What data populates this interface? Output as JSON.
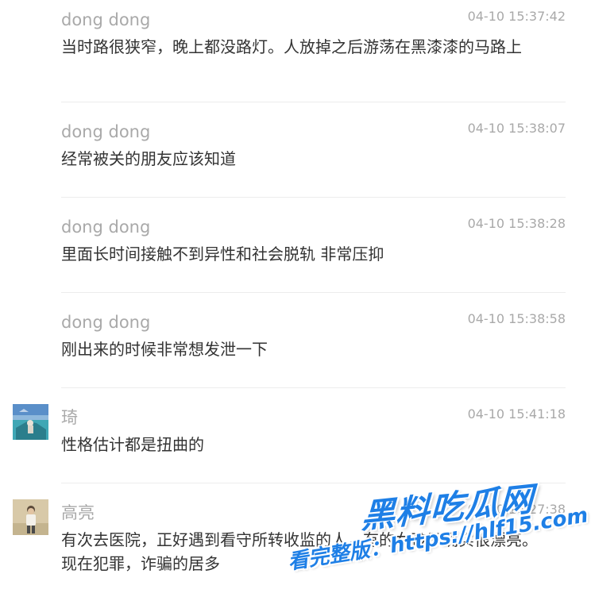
{
  "comments": [
    {
      "author": "dong dong",
      "time": "04-10 15:37:42",
      "text": "当时路很狭窄，晚上都没路灯。人放掉之后游荡在黑漆漆的马路上",
      "avatar": null
    },
    {
      "author": "dong dong",
      "time": "04-10 15:38:07",
      "text": "经常被关的朋友应该知道",
      "avatar": null
    },
    {
      "author": "dong dong",
      "time": "04-10 15:38:28",
      "text": "里面长时间接触不到异性和社会脱轨 非常压抑",
      "avatar": null
    },
    {
      "author": "dong dong",
      "time": "04-10 15:38:58",
      "text": "刚出来的时候非常想发泄一下",
      "avatar": null
    },
    {
      "author": "琦",
      "time": "04-10 15:41:18",
      "text": "性格估计都是扭曲的",
      "avatar": "avatar-beach"
    },
    {
      "author": "高亮",
      "time": "04-10 16:27:38",
      "text": "有次去医院，正好遇到看守所转收监的人，有的女孩子确实很漂亮。现在犯罪，诈骗的居多",
      "avatar": "avatar-person"
    }
  ],
  "watermark": {
    "title": "黑料吃瓜网",
    "subtitle": "看完整版：https://hlf15.com"
  },
  "colors": {
    "meta": "#a9a9a9",
    "text": "#333333",
    "divider": "#ececec",
    "watermark": "#1e7fe6"
  }
}
